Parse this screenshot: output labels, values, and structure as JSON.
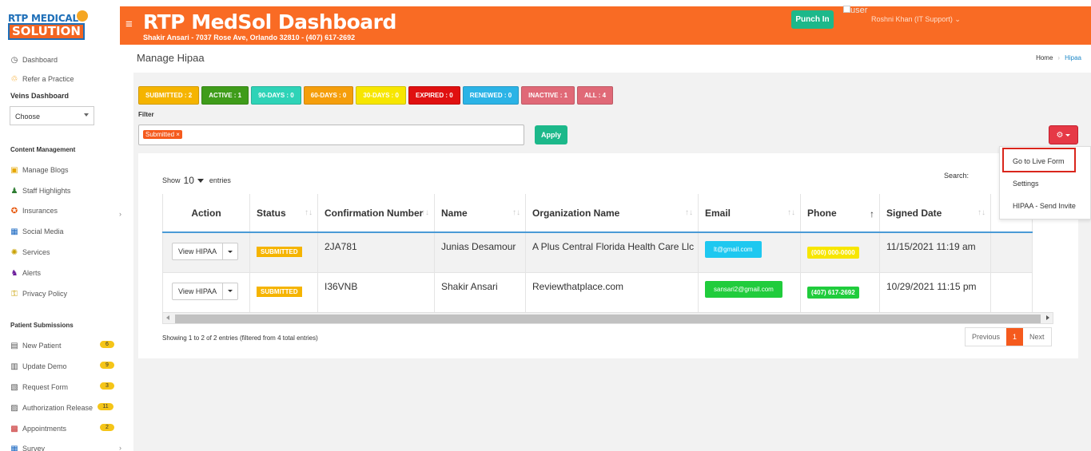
{
  "header": {
    "logo_top": "RTP MEDICAL",
    "logo_bottom": "SOLUTION",
    "title": "RTP MedSol Dashboard",
    "subtitle": "Shakir Ansari - 7037 Rose Ave, Orlando 32810 - (407) 617-2692",
    "punch_in": "Punch In",
    "user_alt": "user",
    "user_name": "Roshni Khan (IT Support)"
  },
  "sidebar": {
    "dashboard": "Dashboard",
    "refer": "Refer a Practice",
    "veins_heading": "Veins Dashboard",
    "choose": "Choose",
    "content_heading": "Content Management",
    "content_items": [
      {
        "label": "Manage Blogs",
        "icon": "blog-icon"
      },
      {
        "label": "Staff Highlights",
        "icon": "staff-icon"
      },
      {
        "label": "Insurances",
        "icon": "insurance-icon"
      },
      {
        "label": "Social Media",
        "icon": "social-media-icon"
      },
      {
        "label": "Services",
        "icon": "services-icon"
      },
      {
        "label": "Alerts",
        "icon": "alerts-icon"
      },
      {
        "label": "Privacy Policy",
        "icon": "privacy-icon"
      }
    ],
    "patient_heading": "Patient Submissions",
    "patient_items": [
      {
        "label": "New Patient",
        "badge": "6"
      },
      {
        "label": "Update Demo",
        "badge": "9"
      },
      {
        "label": "Request Form",
        "badge": "3"
      },
      {
        "label": "Authorization Release",
        "badge": "11"
      },
      {
        "label": "Appointments",
        "badge": "2"
      },
      {
        "label": "Survey",
        "badge": ""
      }
    ]
  },
  "page": {
    "title": "Manage Hipaa",
    "crumb_home": "Home",
    "crumb_current": "Hipaa"
  },
  "filters": [
    {
      "label": "SUBMITTED : 2",
      "color": "#f5b400"
    },
    {
      "label": "ACTIVE : 1",
      "color": "#3f9c1a"
    },
    {
      "label": "90-DAYS : 0",
      "color": "#2ed3b7"
    },
    {
      "label": "60-DAYS : 0",
      "color": "#f59e0b"
    },
    {
      "label": "30-DAYS : 0",
      "color": "#f7e600"
    },
    {
      "label": "EXPIRED : 0",
      "color": "#e01010"
    },
    {
      "label": "RENEWED : 0",
      "color": "#2bb3e6"
    },
    {
      "label": "INACTIVE : 1",
      "color": "#e06977"
    },
    {
      "label": "ALL : 4",
      "color": "#e06977"
    }
  ],
  "filter": {
    "label": "Filter",
    "chip": "Submitted ×",
    "apply": "Apply"
  },
  "gear_menu": {
    "items": [
      "Go to Live Form",
      "Settings",
      "HIPAA - Send Invite"
    ]
  },
  "table": {
    "show": "Show",
    "entries_count": "10",
    "entries": "entries",
    "search": "Search:",
    "columns": [
      "Action",
      "Status",
      "Confirmation Number",
      "Name",
      "Organization Name",
      "Email",
      "Phone",
      "Signed Date"
    ],
    "rows": [
      {
        "action": "View HIPAA",
        "status": "SUBMITTED",
        "confirmation": "2JA781",
        "name": "Junias Desamour",
        "org": "A Plus Central Florida Health Care Llc",
        "email": "lt@gmail.com",
        "email_color": "#1ec8f0",
        "phone": "(000) 000-0000",
        "phone_color": "#f7e600",
        "signed": "11/15/2021 11:19 am"
      },
      {
        "action": "View HIPAA",
        "status": "SUBMITTED",
        "confirmation": "I36VNB",
        "name": "Shakir Ansari",
        "org": "Reviewthatplace.com",
        "email": "sansari2@gmail.com",
        "email_color": "#20cc3c",
        "phone": "(407) 617-2692",
        "phone_color": "#20cc3c",
        "signed": "10/29/2021 11:15 pm"
      }
    ],
    "showing": "Showing 1 to 2 of 2 entries (filtered from 4 total entries)",
    "prev": "Previous",
    "page": "1",
    "next": "Next"
  }
}
